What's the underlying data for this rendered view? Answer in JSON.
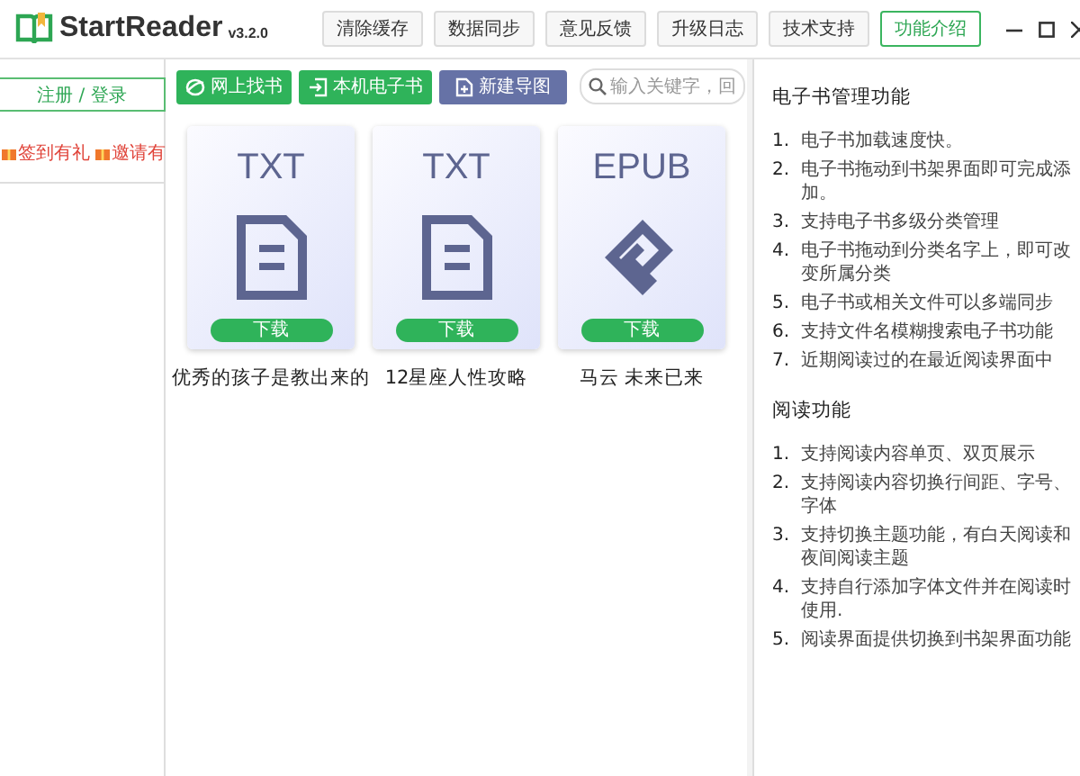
{
  "window": {
    "app_name": "StartReader",
    "version": "v3.2.0"
  },
  "top_buttons": [
    {
      "label": "清除缓存",
      "selected": false
    },
    {
      "label": "数据同步",
      "selected": false
    },
    {
      "label": "意见反馈",
      "selected": false
    },
    {
      "label": "升级日志",
      "selected": false
    },
    {
      "label": "技术支持",
      "selected": false
    },
    {
      "label": "功能介绍",
      "selected": true
    }
  ],
  "sidebar": {
    "login": "注册 / 登录",
    "links": [
      "签到有礼",
      "邀请有"
    ]
  },
  "toolbar": {
    "buttons": [
      {
        "label": "网上找书",
        "kind": "online"
      },
      {
        "label": "本机电子书",
        "kind": "local"
      },
      {
        "label": "新建导图",
        "kind": "mindmap"
      }
    ],
    "search": {
      "placeholder": "输入关键字，回"
    }
  },
  "books": [
    {
      "format": "TXT",
      "kind": "txt",
      "action": "下载",
      "title": "优秀的孩子是教出来的"
    },
    {
      "format": "TXT",
      "kind": "txt",
      "action": "下载",
      "title": "12星座人性攻略"
    },
    {
      "format": "EPUB",
      "kind": "epub",
      "action": "下载",
      "title": "马云 未来已来"
    }
  ],
  "features": [
    {
      "title": "电子书管理功能",
      "items": [
        {
          "number": "1.",
          "text": "电子书加载速度快。"
        },
        {
          "number": "2.",
          "text": "电子书拖动到书架界面即可完成添加。"
        },
        {
          "number": "3.",
          "text": "支持电子书多级分类管理"
        },
        {
          "number": "4.",
          "text": "电子书拖动到分类名字上，即可改变所属分类"
        },
        {
          "number": "5.",
          "text": "电子书或相关文件可以多端同步"
        },
        {
          "number": "6.",
          "text": "支持文件名模糊搜索电子书功能"
        },
        {
          "number": "7.",
          "text": "近期阅读过的在最近阅读界面中"
        }
      ]
    },
    {
      "title": "阅读功能",
      "items": [
        {
          "number": "1.",
          "text": "支持阅读内容单页、双页展示"
        },
        {
          "number": "2.",
          "text": "支持阅读内容切换行间距、字号、字体"
        },
        {
          "number": "3.",
          "text": "支持切换主题功能，有白天阅读和夜间阅读主题"
        },
        {
          "number": "4.",
          "text": "支持自行添加字体文件并在阅读时使用."
        },
        {
          "number": "5.",
          "text": "阅读界面提供切换到书架界面功能"
        }
      ]
    }
  ]
}
